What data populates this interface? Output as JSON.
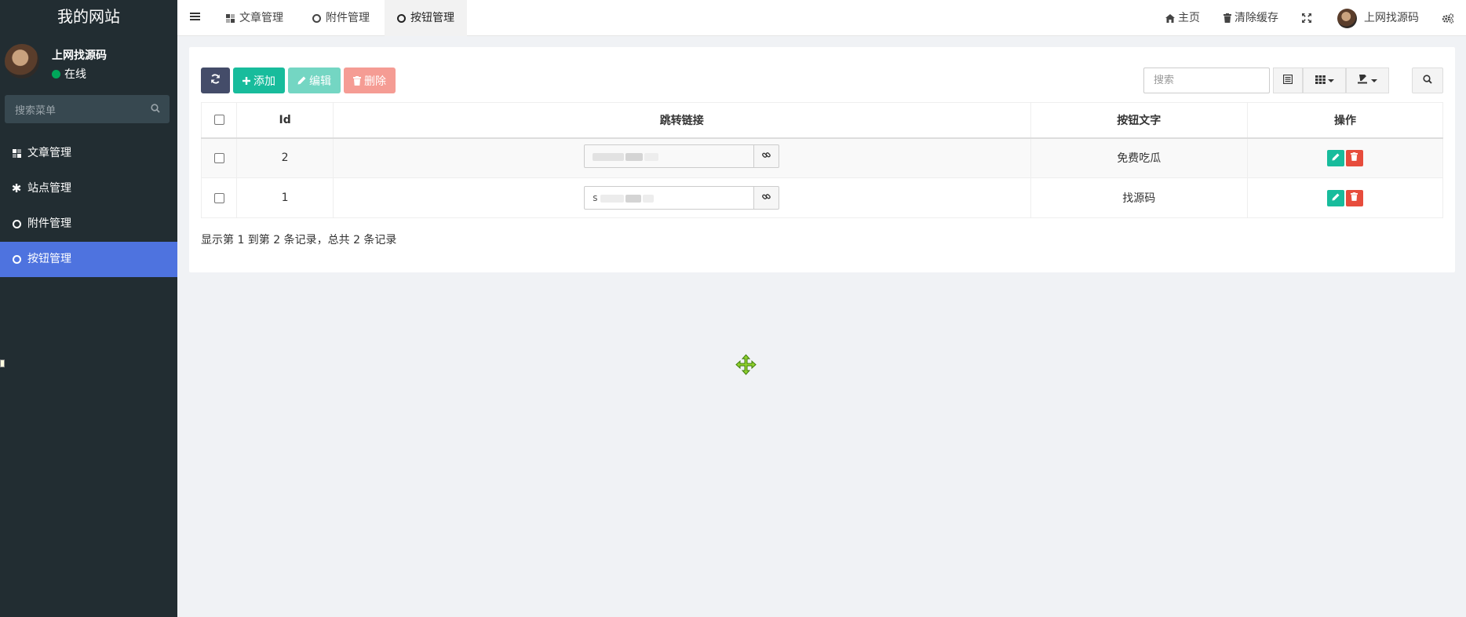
{
  "app": {
    "logo": "我的网站"
  },
  "user": {
    "name": "上网找源码",
    "status": "在线",
    "status_color": "#00a65a"
  },
  "sidebar": {
    "search_placeholder": "搜索菜单",
    "items": [
      {
        "label": "文章管理",
        "icon": "dashboard-icon",
        "active": false
      },
      {
        "label": "站点管理",
        "icon": "asterisk-icon",
        "active": false
      },
      {
        "label": "附件管理",
        "icon": "circle-icon",
        "active": false
      },
      {
        "label": "按钮管理",
        "icon": "circle-icon",
        "active": true
      }
    ]
  },
  "topbar": {
    "tabs": [
      {
        "label": "文章管理",
        "icon": "dashboard-icon"
      },
      {
        "label": "附件管理",
        "icon": "circle-icon"
      },
      {
        "label": "按钮管理",
        "icon": "circle-icon",
        "active": true
      }
    ],
    "home_label": "主页",
    "clear_cache_label": "清除缓存",
    "username": "上网找源码"
  },
  "toolbar": {
    "add_label": "添加",
    "edit_label": "编辑",
    "delete_label": "删除",
    "search_placeholder": "搜索"
  },
  "table": {
    "columns": [
      "Id",
      "跳转链接",
      "按钮文字",
      "操作"
    ],
    "rows": [
      {
        "id": "2",
        "link": "",
        "text": "免费吃瓜"
      },
      {
        "id": "1",
        "link": "s",
        "text": "找源码"
      }
    ]
  },
  "pagination": {
    "summary": "显示第 1 到第 2 条记录，总共 2 条记录"
  },
  "colors": {
    "sidebar_bg": "#222d32",
    "active_item": "#4e73df",
    "add": "#18bc9c",
    "delete": "#e74c3c"
  }
}
